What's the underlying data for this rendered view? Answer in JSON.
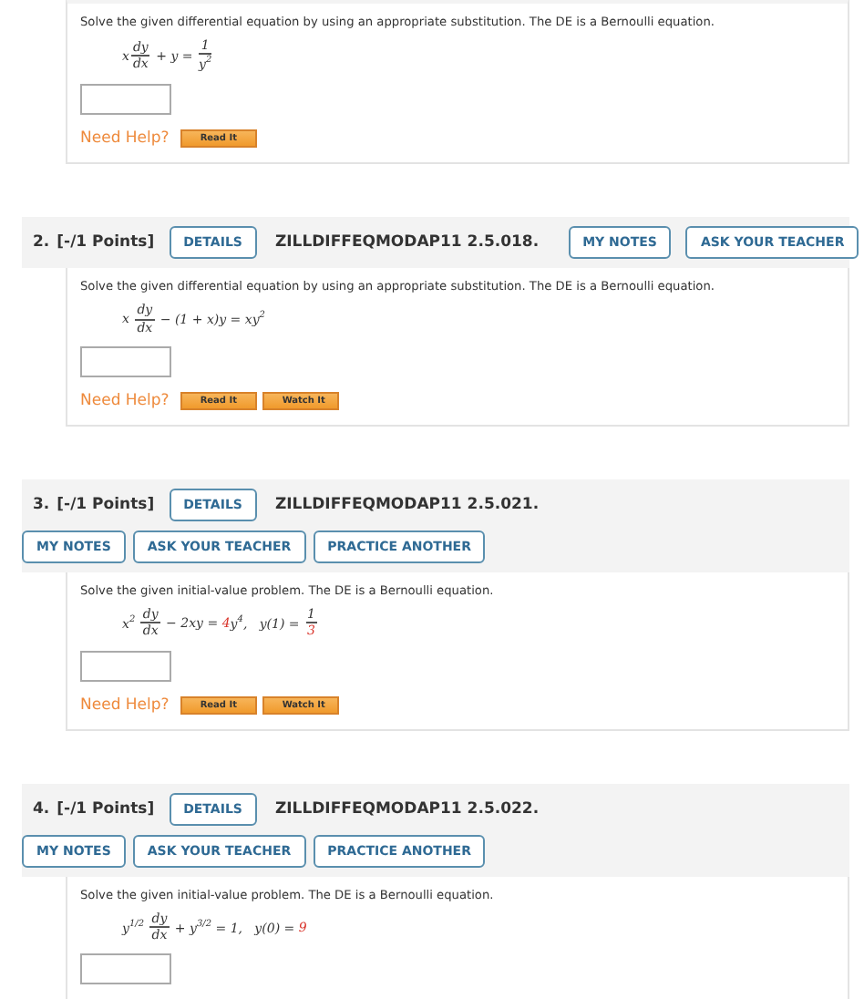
{
  "problems": [
    {
      "prompt": "Solve the given differential equation by using an appropriate substitution. The DE is a Bernoulli equation.",
      "equation": [
        {
          "kind": "text",
          "text": "x"
        },
        {
          "kind": "frac",
          "num": {
            "kind": "text",
            "text": "dy"
          },
          "den": {
            "kind": "text",
            "text": "dx"
          }
        },
        {
          "kind": "text",
          "text": " + y = "
        },
        {
          "kind": "frac",
          "num": {
            "kind": "text",
            "text": "1"
          },
          "den": {
            "kind": "text",
            "text": "y$^{2}$"
          }
        }
      ],
      "help": {
        "label": "Need Help?",
        "buttons": [
          "Read It"
        ]
      }
    },
    {
      "header": {
        "kind": "inline",
        "number": "2.",
        "points": "[-/1 Points]",
        "details": "DETAILS",
        "code": "ZILLDIFFEQMODAP11 2.5.018.",
        "buttons": [
          "MY NOTES",
          "ASK YOUR TEACHER"
        ]
      },
      "prompt": "Solve the given differential equation by using an appropriate substitution. The DE is a Bernoulli equation.",
      "equation": [
        {
          "kind": "text",
          "text": "x "
        },
        {
          "kind": "frac",
          "num": {
            "kind": "text",
            "text": "dy"
          },
          "den": {
            "kind": "text",
            "text": "dx"
          }
        },
        {
          "kind": "text",
          "text": " − (1 + x)y = xy$^{2}$"
        }
      ],
      "help": {
        "label": "Need Help?",
        "buttons": [
          "Read It",
          "Watch It"
        ]
      }
    },
    {
      "header": {
        "kind": "stacked",
        "number": "3.",
        "points": "[-/1 Points]",
        "details": "DETAILS",
        "code": "ZILLDIFFEQMODAP11 2.5.021.",
        "buttons": [
          "MY NOTES",
          "ASK YOUR TEACHER",
          "PRACTICE ANOTHER"
        ]
      },
      "prompt": "Solve the given initial-value problem. The DE is a Bernoulli equation.",
      "equation": [
        {
          "kind": "text",
          "text": "x$^{2}$ "
        },
        {
          "kind": "frac",
          "num": {
            "kind": "text",
            "text": "dy"
          },
          "den": {
            "kind": "text",
            "text": "dx"
          }
        },
        {
          "kind": "text",
          "text": " − 2xy = "
        },
        {
          "kind": "value",
          "text": "4"
        },
        {
          "kind": "text",
          "text": "y$^{4}$,   y(1) = "
        },
        {
          "kind": "frac",
          "num": {
            "kind": "text",
            "text": "1"
          },
          "den": {
            "kind": "value",
            "text": "3"
          }
        }
      ],
      "help": {
        "label": "Need Help?",
        "buttons": [
          "Read It",
          "Watch It"
        ]
      }
    },
    {
      "header": {
        "kind": "stacked",
        "number": "4.",
        "points": "[-/1 Points]",
        "details": "DETAILS",
        "code": "ZILLDIFFEQMODAP11 2.5.022.",
        "buttons": [
          "MY NOTES",
          "ASK YOUR TEACHER",
          "PRACTICE ANOTHER"
        ]
      },
      "prompt": "Solve the given initial-value problem. The DE is a Bernoulli equation.",
      "equation": [
        {
          "kind": "text",
          "text": "y$^{1/2}$ "
        },
        {
          "kind": "frac",
          "num": {
            "kind": "text",
            "text": "dy"
          },
          "den": {
            "kind": "text",
            "text": "dx"
          }
        },
        {
          "kind": "text",
          "text": " + y$^{3/2}$ = 1,   y(0) = "
        },
        {
          "kind": "value",
          "text": "9"
        }
      ]
    }
  ]
}
